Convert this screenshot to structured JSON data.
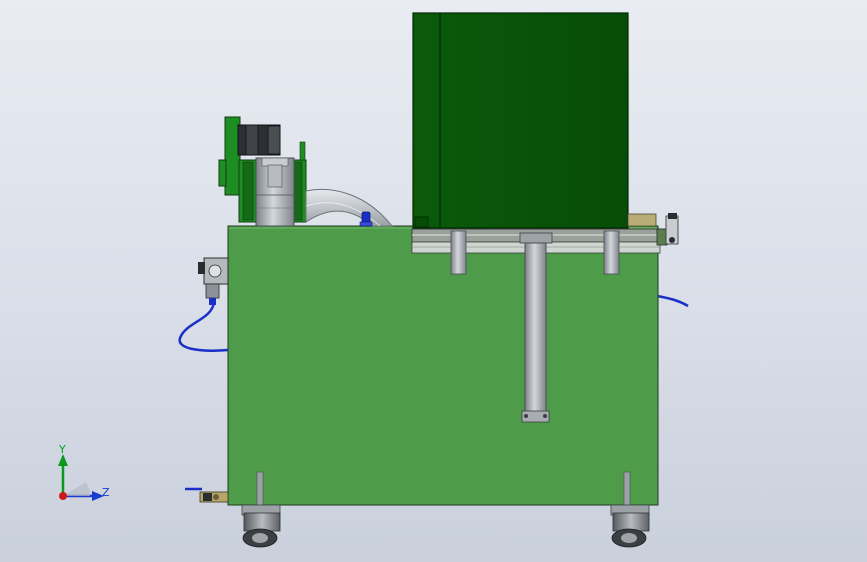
{
  "viewport": {
    "background_top": "#e9ecf2",
    "background_bottom": "#c9d0dc"
  },
  "colors": {
    "tank_green": "#4e9b4a",
    "cabinet_dark_green": "#0a5c0a",
    "motor_green": "#1e8e22",
    "hose_blue": "#1a2fc8",
    "steel_gray": "#a8adb3"
  },
  "triad": {
    "y_label": "Y",
    "z_label": "Z",
    "y_color": "#0a9a1a",
    "z_color": "#1c3bd0",
    "origin_color": "#d01818"
  },
  "parts": [
    "cabinet",
    "tank",
    "motor-assembly",
    "duct-elbow",
    "filter-regulator",
    "air-hose",
    "cylinder",
    "frame-rail",
    "drain-valve",
    "caster-wheel"
  ]
}
